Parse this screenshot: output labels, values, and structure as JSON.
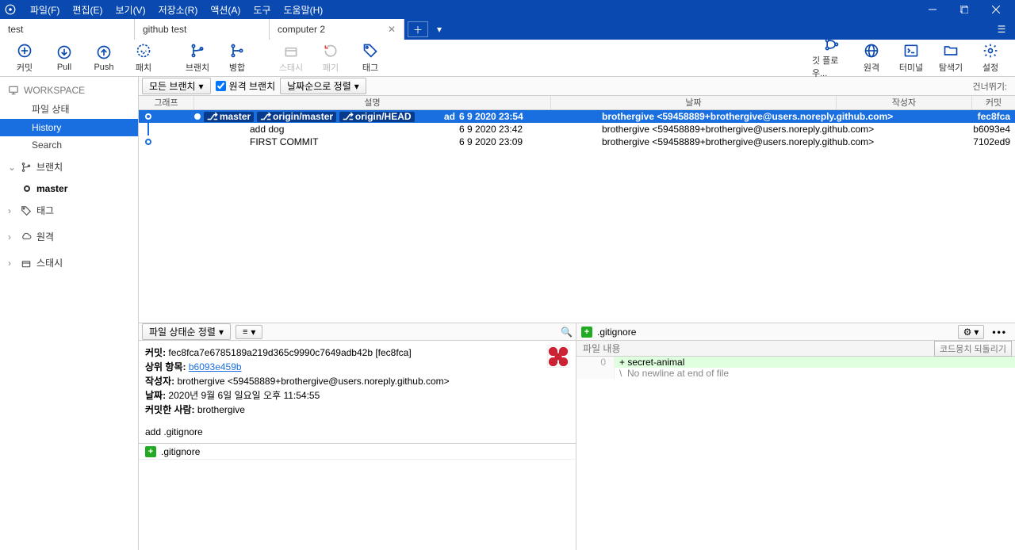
{
  "menu": {
    "file": "파일(F)",
    "edit": "편집(E)",
    "view": "보기(V)",
    "repo": "저장소(R)",
    "action": "액션(A)",
    "tools": "도구",
    "help": "도움말(H)"
  },
  "tabs": [
    {
      "label": "test"
    },
    {
      "label": "github test"
    },
    {
      "label": "computer 2"
    }
  ],
  "toolbar": {
    "commit": "커밋",
    "pull": "Pull",
    "push": "Push",
    "patch": "패치",
    "branch": "브랜치",
    "merge": "병합",
    "stash": "스태시",
    "discard": "폐기",
    "tag": "태그",
    "gitflow": "깃 플로우...",
    "remote": "원격",
    "terminal": "터미널",
    "explorer": "탐색기",
    "settings": "설정"
  },
  "sidebar": {
    "workspace": "WORKSPACE",
    "filestatus": "파일 상태",
    "history": "History",
    "search": "Search",
    "branches": "브랜치",
    "master": "master",
    "tags": "태그",
    "remotes": "원격",
    "stashes": "스태시"
  },
  "filter": {
    "allbranches": "모든 브랜치",
    "remote": "원격 브랜치",
    "datesort": "날짜순으로 정렬",
    "skip": "건너뛰기:"
  },
  "cols": {
    "graph": "그래프",
    "desc": "설명",
    "date": "날짜",
    "author": "작성자",
    "commit": "커밋"
  },
  "badges": {
    "master": "master",
    "origin_master": "origin/master",
    "origin_head": "origin/HEAD"
  },
  "rows": [
    {
      "desc": "",
      "initials": "ad",
      "date": "6 9 2020 23:54",
      "author": "brothergive <59458889+brothergive@users.noreply.github.com>",
      "hash": "fec8fca",
      "sel": true
    },
    {
      "desc": "add dog",
      "initials": "",
      "date": "6 9 2020 23:42",
      "author": "brothergive <59458889+brothergive@users.noreply.github.com>",
      "hash": "b6093e4",
      "sel": false
    },
    {
      "desc": "FIRST COMMIT",
      "initials": "",
      "date": "6 9 2020 23:09",
      "author": "brothergive <59458889+brothergive@users.noreply.github.com>",
      "hash": "7102ed9",
      "sel": false
    }
  ],
  "detail": {
    "sort_btn": "파일 상태순 정렬",
    "commit_l": "커밋:",
    "commit_v": "fec8fca7e6785189a219d365c9990c7649adb42b [fec8fca]",
    "parent_l": "상위 항목:",
    "parent_v": "b6093e459b",
    "author_l": "작성자:",
    "author_v": "brothergive <59458889+brothergive@users.noreply.github.com>",
    "date_l": "날짜:",
    "date_v": "2020년 9월 6일 일요일 오후 11:54:55",
    "committer_l": "커밋한 사람:",
    "committer_v": "brothergive",
    "msg": "add .gitignore",
    "file": ".gitignore"
  },
  "diff": {
    "file": ".gitignore",
    "filecontent": "파일 내용",
    "revert": "코드뭉치 되돌리기",
    "line0": "0",
    "l1": "+ secret-animal",
    "l2": "\\  No newline at end of file"
  }
}
